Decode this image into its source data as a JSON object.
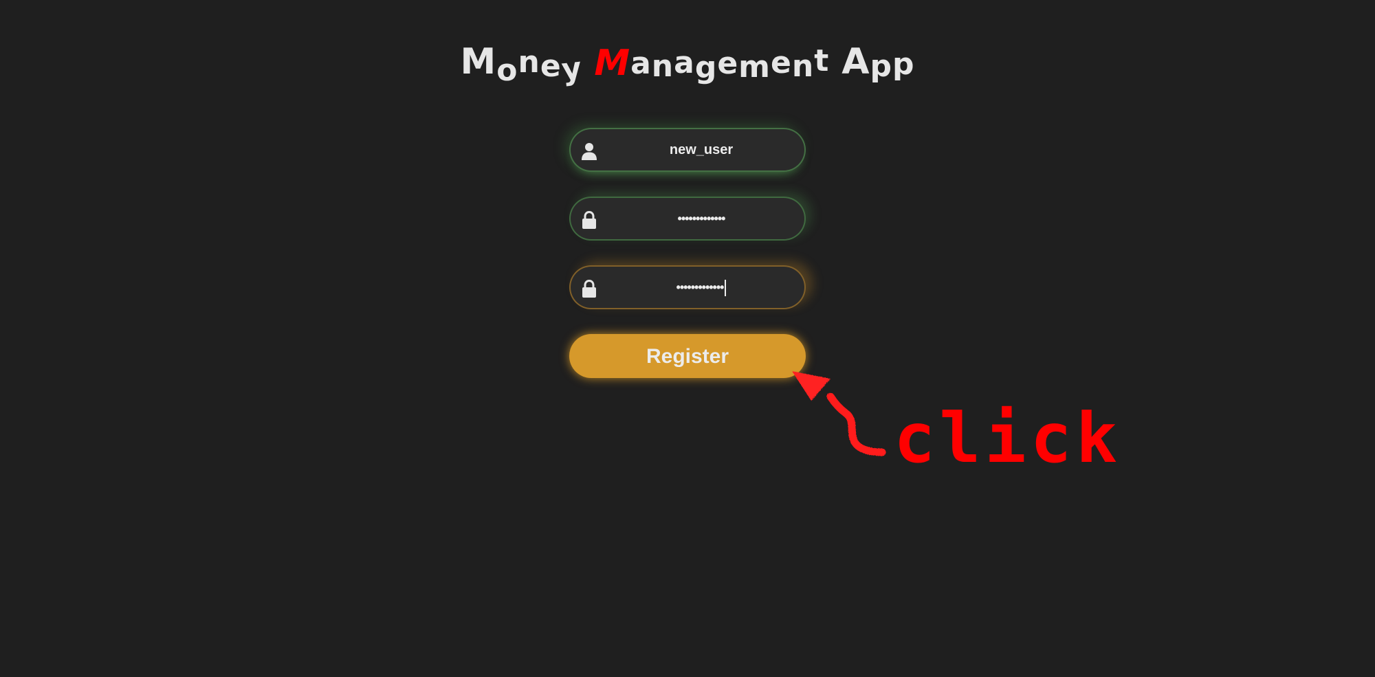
{
  "app": {
    "title_parts": [
      "Money",
      "M",
      "anagement App"
    ]
  },
  "form": {
    "username_value": "new_user",
    "password_value": "•••••••••••••",
    "confirm_password_value": "•••••••••••••",
    "register_label": "Register"
  },
  "annotation": {
    "text": "click"
  },
  "colors": {
    "background": "#1f1f1f",
    "field_bg": "#2a2a2a",
    "accent_orange": "#d6992b",
    "title_accent": "#ff0000",
    "annotation_red": "#ff0000"
  },
  "icons": {
    "username": "user-icon",
    "password": "lock-icon",
    "confirm_password": "lock-icon"
  }
}
